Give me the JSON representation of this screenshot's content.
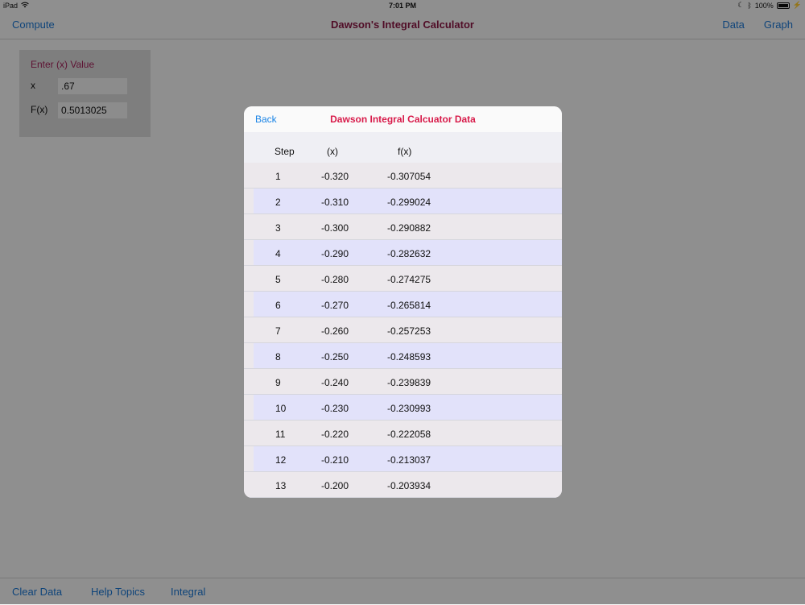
{
  "status": {
    "device": "iPad",
    "time": "7:01 PM",
    "battery": "100%"
  },
  "nav": {
    "left_label": "Compute",
    "title": "Dawson's Integral Calculator",
    "right_items": [
      "Data",
      "Graph"
    ]
  },
  "calculator": {
    "heading": "Enter (x) Value",
    "x_label": "x",
    "x_value": ".67",
    "fx_label": "F(x)",
    "fx_value": "0.5013025"
  },
  "toolbar": {
    "items": [
      "Clear Data",
      "Help Topics",
      "Integral"
    ]
  },
  "modal": {
    "back_label": "Back",
    "title": "Dawson Integral Calcuator Data",
    "columns": [
      "Step",
      "(x)",
      "f(x)"
    ],
    "rows": [
      [
        "1",
        "-0.320",
        "-0.307054"
      ],
      [
        "2",
        "-0.310",
        "-0.299024"
      ],
      [
        "3",
        "-0.300",
        "-0.290882"
      ],
      [
        "4",
        "-0.290",
        "-0.282632"
      ],
      [
        "5",
        "-0.280",
        "-0.274275"
      ],
      [
        "6",
        "-0.270",
        "-0.265814"
      ],
      [
        "7",
        "-0.260",
        "-0.257253"
      ],
      [
        "8",
        "-0.250",
        "-0.248593"
      ],
      [
        "9",
        "-0.240",
        "-0.239839"
      ],
      [
        "10",
        "-0.230",
        "-0.230993"
      ],
      [
        "11",
        "-0.220",
        "-0.222058"
      ],
      [
        "12",
        "-0.210",
        "-0.213037"
      ],
      [
        "13",
        "-0.200",
        "-0.203934"
      ]
    ]
  },
  "colors": {
    "accent": "#1a76d2",
    "title": "#8a1744",
    "modal_title": "#d81b4a"
  }
}
